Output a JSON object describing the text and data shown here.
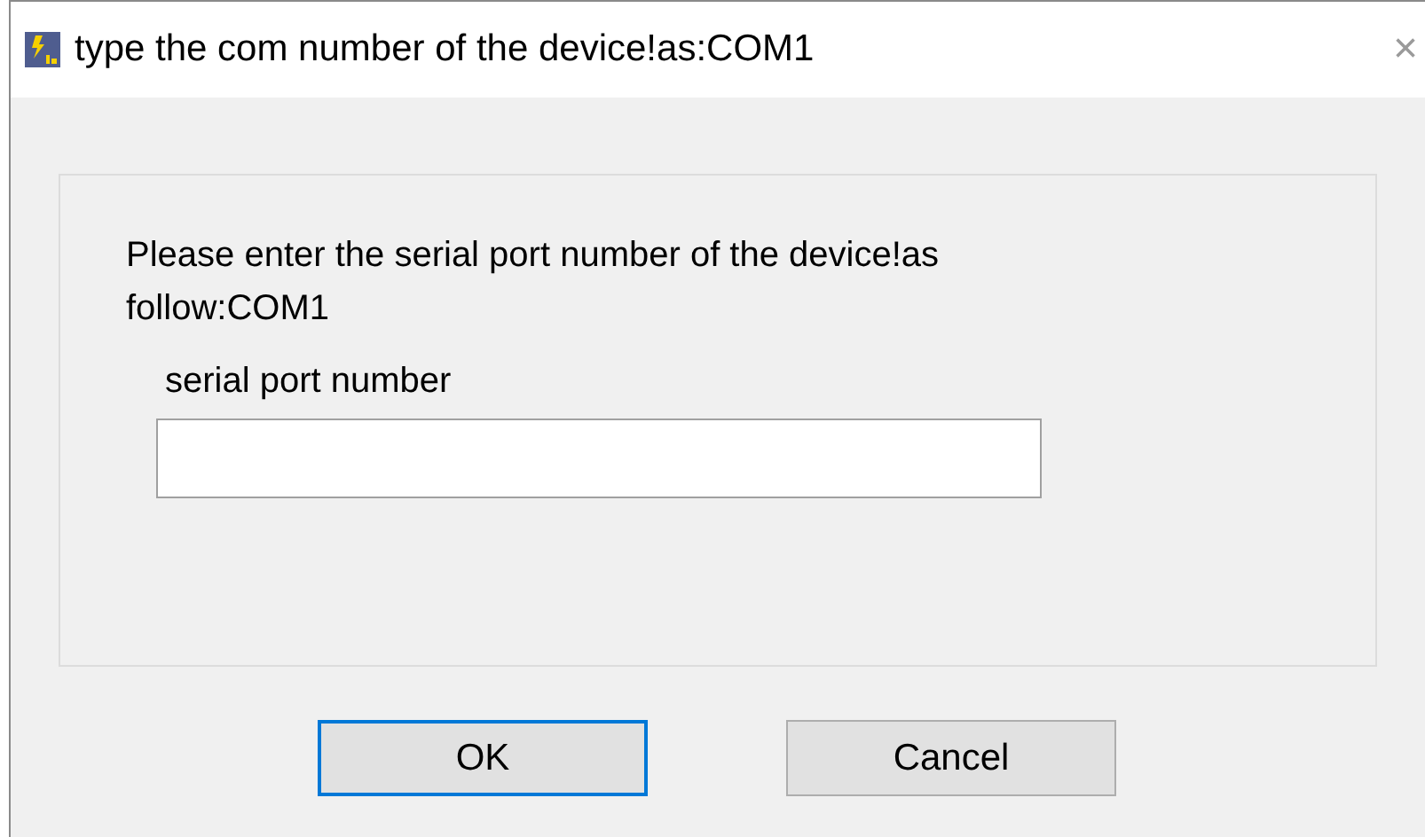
{
  "window": {
    "title": "type the com number of the device!as:COM1",
    "close": "×"
  },
  "message": "Please enter the serial port number of the device!as follow:COM1",
  "field": {
    "label": "serial port number"
  },
  "buttons": [
    {
      "label": "OK",
      "default": true
    },
    {
      "label": "Cancel",
      "default": false
    }
  ]
}
